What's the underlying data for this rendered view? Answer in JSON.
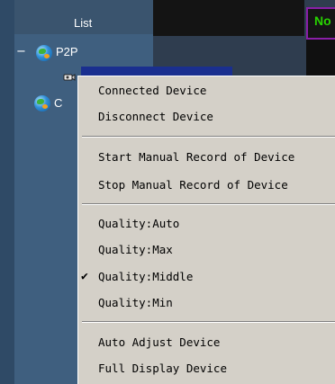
{
  "panel": {
    "title": "List",
    "tree": {
      "expand_symbol": "−",
      "root_label": "P2P",
      "second_label": "C"
    }
  },
  "right_tab": {
    "label": "No"
  },
  "context_menu": {
    "items": [
      {
        "label": "Connected Device",
        "checked": false
      },
      {
        "label": "Disconnect Device",
        "checked": false
      },
      {
        "label": "Start Manual Record of Device",
        "checked": false
      },
      {
        "label": "Stop Manual Record of Device",
        "checked": false
      },
      {
        "label": "Quality:Auto",
        "checked": false
      },
      {
        "label": "Quality:Max",
        "checked": false
      },
      {
        "label": "Quality:Middle",
        "checked": true,
        "check_mark": "✔"
      },
      {
        "label": "Quality:Min",
        "checked": false
      },
      {
        "label": "Auto Adjust Device",
        "checked": false
      },
      {
        "label": "Full Display Device",
        "checked": false
      }
    ]
  },
  "colors": {
    "panel_bg": "#3f5f7f",
    "menu_bg": "#d4d0c8",
    "tab_border": "#8a1fa8",
    "tab_text": "#28d400",
    "selection": "#1a2f8f"
  }
}
